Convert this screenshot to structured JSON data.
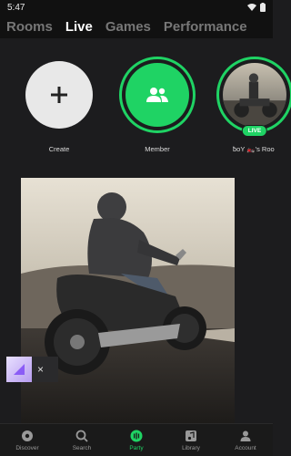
{
  "status_bar": {
    "time": "5:47"
  },
  "tabs": [
    {
      "label": "Rooms"
    },
    {
      "label": "Live",
      "active": true
    },
    {
      "label": "Games"
    },
    {
      "label": "Performance"
    }
  ],
  "stories": [
    {
      "label": "Create",
      "icon": "plus-icon"
    },
    {
      "label": "Member",
      "icon": "group-icon"
    },
    {
      "label": "ƀoY 🏍️'s Roo",
      "badge": "LIVE"
    }
  ],
  "mini_player": {
    "close_glyph": "×"
  },
  "bottom_nav": [
    {
      "label": "Discover",
      "icon": "discover-icon"
    },
    {
      "label": "Search",
      "icon": "search-icon"
    },
    {
      "label": "Party",
      "icon": "party-icon",
      "active": true
    },
    {
      "label": "Library",
      "icon": "library-icon"
    },
    {
      "label": "Account",
      "icon": "account-icon"
    }
  ],
  "colors": {
    "accent": "#1fd364",
    "background": "#1c1c1e",
    "bar": "#111111"
  }
}
